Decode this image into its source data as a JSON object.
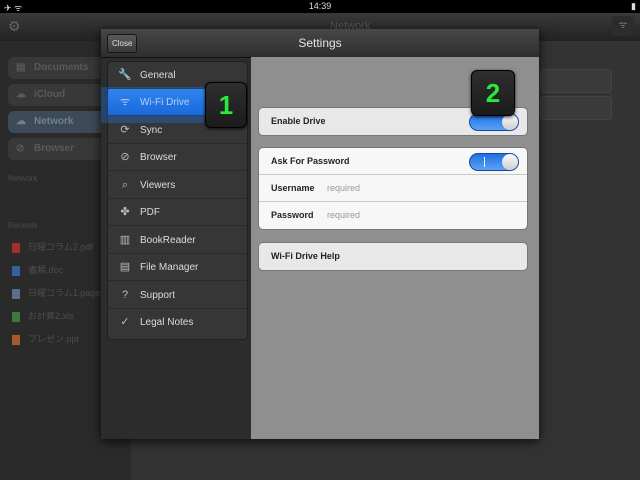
{
  "status_bar": {
    "time": "14:39",
    "left_icons": "✈ ᯤ",
    "right_icons": "▮"
  },
  "background_app": {
    "title": "Network",
    "sidebar": {
      "items": [
        {
          "label": "Documents"
        },
        {
          "label": "iCloud"
        },
        {
          "label": "Network"
        },
        {
          "label": "Browser"
        }
      ],
      "network_heading": "Network",
      "recent_heading": "Recents",
      "recent_files": [
        {
          "name": "日曜コラム2.pdf",
          "color": "#a03030"
        },
        {
          "name": "書類.doc",
          "color": "#355f9e"
        },
        {
          "name": "日曜コラム1.pages",
          "color": "#5a6f8a"
        },
        {
          "name": "お計算2.xls",
          "color": "#3c7a3c"
        },
        {
          "name": "プレゼン.ppt",
          "color": "#a55a2a"
        }
      ]
    }
  },
  "modal": {
    "title": "Settings",
    "close_label": "Close",
    "menu": [
      {
        "label": "General",
        "icon": "wrench-icon",
        "glyph": "🔧"
      },
      {
        "label": "Wi-Fi Drive",
        "icon": "wifi-icon",
        "glyph": "ᯤ"
      },
      {
        "label": "Sync",
        "icon": "sync-icon",
        "glyph": "⟳"
      },
      {
        "label": "Browser",
        "icon": "compass-icon",
        "glyph": "⊘"
      },
      {
        "label": "Viewers",
        "icon": "search-icon",
        "glyph": "⌕"
      },
      {
        "label": "PDF",
        "icon": "pdf-icon",
        "glyph": "✤"
      },
      {
        "label": "BookReader",
        "icon": "book-icon",
        "glyph": "▥"
      },
      {
        "label": "File Manager",
        "icon": "file-icon",
        "glyph": "▤"
      },
      {
        "label": "Support",
        "icon": "question-icon",
        "glyph": "?"
      },
      {
        "label": "Legal Notes",
        "icon": "check-icon",
        "glyph": "✓"
      }
    ],
    "detail": {
      "enable_drive": {
        "label": "Enable Drive"
      },
      "ask_password": {
        "label": "Ask For Password",
        "on": true
      },
      "username": {
        "label": "Username",
        "placeholder": "required"
      },
      "password": {
        "label": "Password",
        "placeholder": "required"
      },
      "help_label": "Wi-Fi Drive Help"
    }
  },
  "annotations": {
    "callout_1": "1",
    "callout_2": "2",
    "callout_color": "#2ce83b"
  }
}
